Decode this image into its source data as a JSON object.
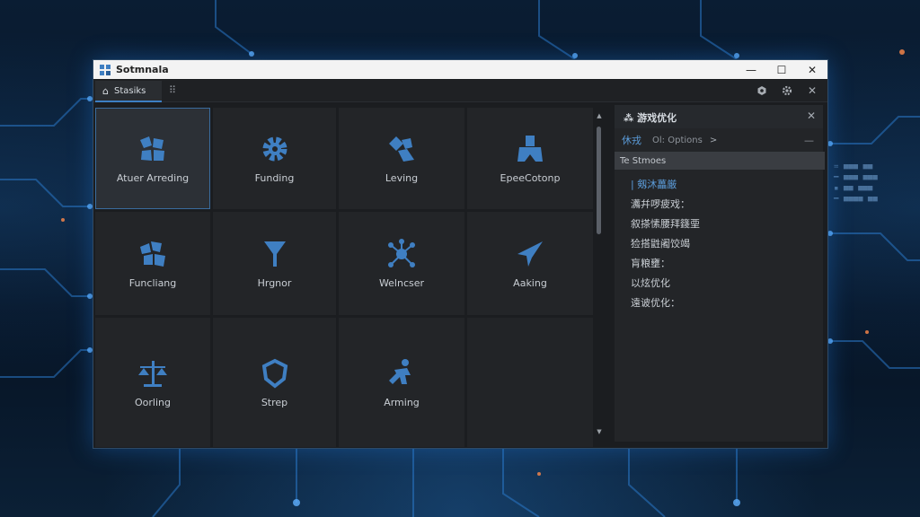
{
  "window": {
    "title": "Sotmnala",
    "controls": {
      "minimize": "—",
      "maximize": "☐",
      "close": "✕"
    }
  },
  "tabbar": {
    "home_tab": "Stasiks",
    "grid_glyph": "⠿",
    "tools": [
      "settings-box-icon",
      "gear-icon",
      "close-icon"
    ]
  },
  "grid": {
    "tiles": [
      {
        "label": "Atuer Arreding",
        "icon": "blocks-icon",
        "selected": true
      },
      {
        "label": "Funding",
        "icon": "gear-icon",
        "selected": false
      },
      {
        "label": "Leving",
        "icon": "diamond-tools-icon",
        "selected": false
      },
      {
        "label": "EpeeCotonp",
        "icon": "figure-icon",
        "selected": false
      },
      {
        "label": "Funcliang",
        "icon": "cubes-icon",
        "selected": false
      },
      {
        "label": "Hrgnor",
        "icon": "funnel-icon",
        "selected": false
      },
      {
        "label": "Welncser",
        "icon": "network-icon",
        "selected": false
      },
      {
        "label": "Aaking",
        "icon": "paper-plane-icon",
        "selected": false
      },
      {
        "label": "Oorling",
        "icon": "scales-icon",
        "selected": false
      },
      {
        "label": "Strep",
        "icon": "shield-icon",
        "selected": false
      },
      {
        "label": "Arming",
        "icon": "runner-icon",
        "selected": false
      },
      {
        "label": "",
        "icon": "",
        "selected": false
      }
    ]
  },
  "panel": {
    "title": "游戏优化",
    "title_glyph": "⁂",
    "close": "✕",
    "sub": {
      "lang": "休戎",
      "prefix": "Ol:",
      "options": "Options",
      "chevron": ">",
      "collapse": "—"
    },
    "section": "Te Stmoes",
    "items": [
      {
        "label": "| 剱沐藟厳",
        "active": true
      },
      {
        "label": "瀳幷啰疲戏：",
        "active": false
      },
      {
        "label": "叙搽愫腰拜籛垔",
        "active": false
      },
      {
        "label": "猃搭鼪阇饺竭",
        "active": false
      },
      {
        "label": "肓粮壅：",
        "active": false
      },
      {
        "label": "以炫优化",
        "active": false
      },
      {
        "label": "遠诐优化：",
        "active": false
      }
    ]
  },
  "colors": {
    "accent": "#3d7fc4",
    "accent_text": "#5b9bd8",
    "icon_blue": "#3f7fc2",
    "window_bg": "#1b1d20",
    "tile_bg": "#232528"
  }
}
